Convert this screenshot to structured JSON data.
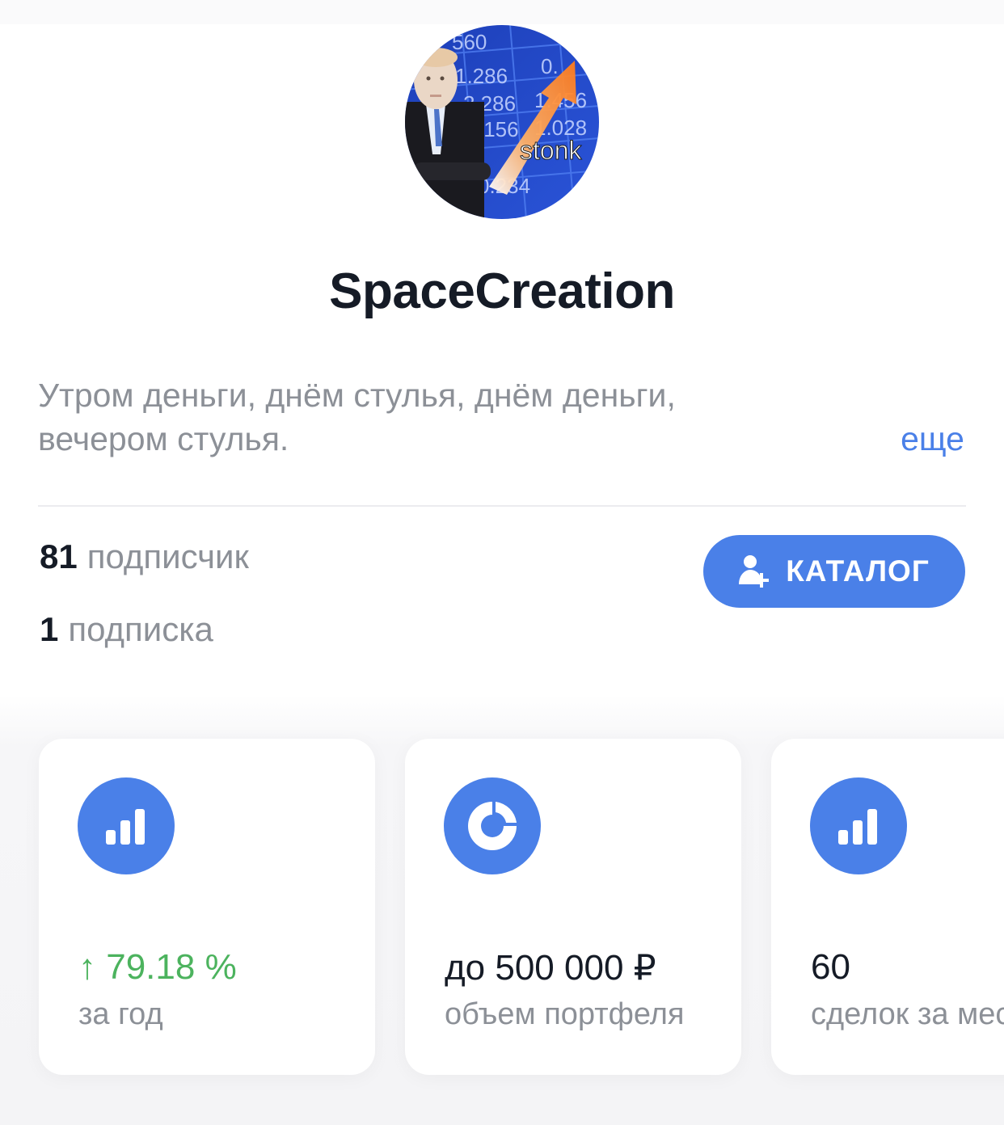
{
  "profile": {
    "name": "SpaceCreation",
    "avatar_overlay_text": "stonk",
    "description_line1": "Утром деньги, днём стулья, днём деньги,",
    "description_line2": "вечером стулья.",
    "more_label": "еще"
  },
  "stats": {
    "followers_count": "81",
    "followers_label": "подписчик",
    "following_count": "1",
    "following_label": "подписка"
  },
  "catalog_button": {
    "label": "КАТАЛОГ",
    "icon": "add-user-icon"
  },
  "cards": [
    {
      "icon": "bar-chart-icon",
      "arrow": "↑",
      "value": "79.18 %",
      "label": "за год"
    },
    {
      "icon": "pie-chart-icon",
      "value": "до 500 000 ₽",
      "label": "объем портфеля"
    },
    {
      "icon": "bar-chart-icon",
      "value": "60",
      "label": "сделок за месяц"
    }
  ],
  "colors": {
    "accent": "#4a80e8",
    "positive": "#4cb35e",
    "text_primary": "#151b26",
    "text_secondary": "#8c9097"
  }
}
